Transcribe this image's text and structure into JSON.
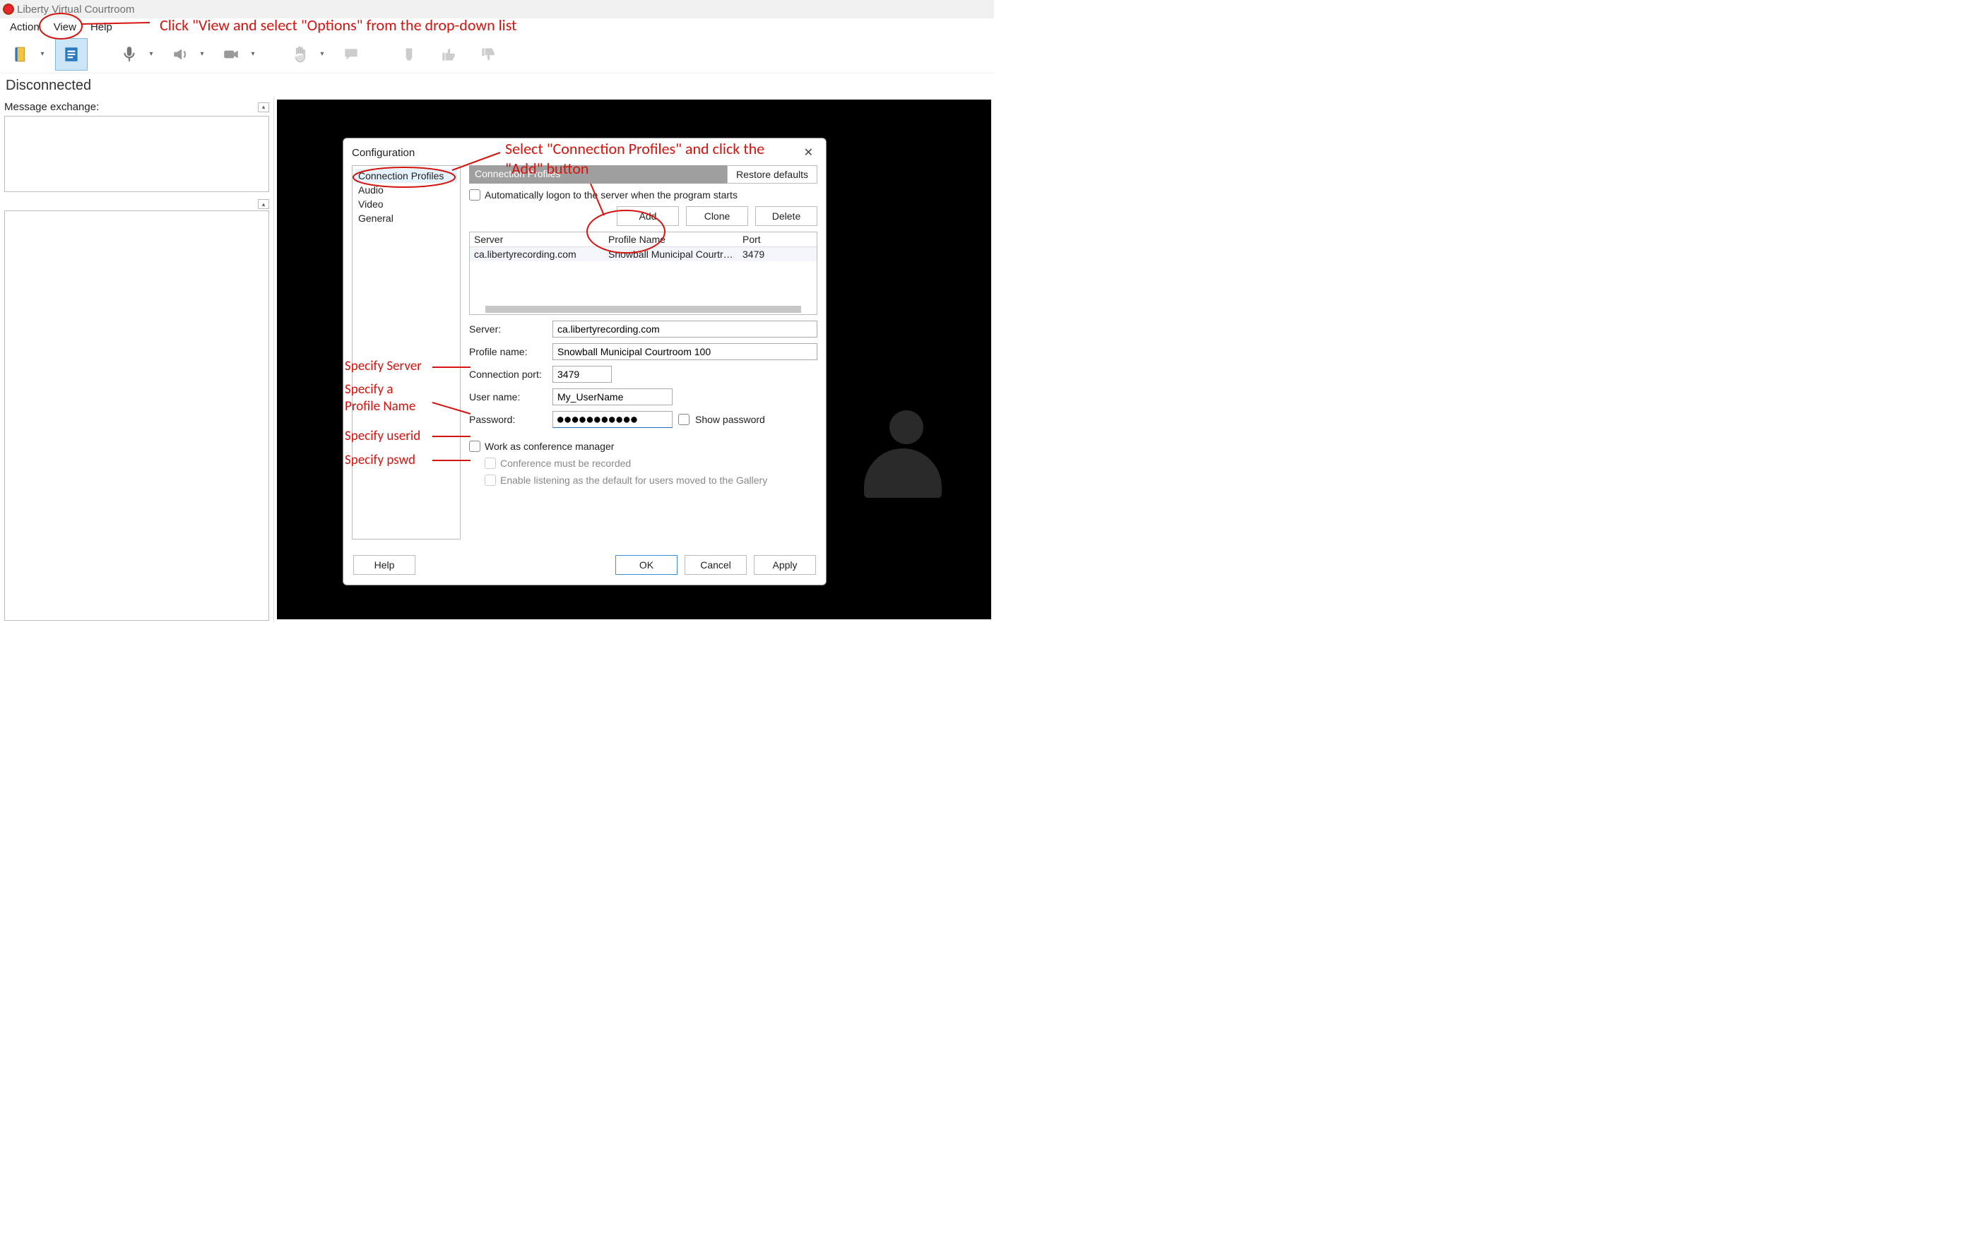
{
  "app": {
    "title": "Liberty Virtual Courtroom"
  },
  "menubar": {
    "action": "Action",
    "view": "View",
    "help": "Help"
  },
  "toolbar": {
    "icons": [
      "door-exit-icon",
      "notes-icon",
      "microphone-icon",
      "speaker-icon",
      "camera-icon",
      "hand-raise-icon",
      "chat-icon",
      "glove-icon",
      "thumb-up-icon",
      "thumb-down-icon"
    ]
  },
  "status": {
    "text": "Disconnected"
  },
  "left": {
    "message_exchange_label": "Message exchange:"
  },
  "dialog": {
    "title": "Configuration",
    "close_glyph": "✕",
    "side": {
      "connection_profiles": "Connection Profiles",
      "audio": "Audio",
      "video": "Video",
      "general": "General"
    },
    "section_title": "Connection Profiles",
    "restore_defaults": "Restore defaults",
    "auto_logon": "Automatically logon to the server when the program starts",
    "buttons": {
      "add": "Add",
      "clone": "Clone",
      "delete": "Delete"
    },
    "table": {
      "headers": {
        "server": "Server",
        "profile": "Profile Name",
        "port": "Port"
      },
      "rows": [
        {
          "server": "ca.libertyrecording.com",
          "profile": "Snowball Municipal Courtroo...",
          "port": "3479"
        }
      ]
    },
    "form": {
      "server_label": "Server:",
      "server_value": "ca.libertyrecording.com",
      "profile_label": "Profile name:",
      "profile_value": "Snowball Municipal Courtroom 100",
      "port_label": "Connection port:",
      "port_value": "3479",
      "user_label": "User name:",
      "user_value": "My_UserName",
      "pass_label": "Password:",
      "pass_value_masked": "●●●●●●●●●●●",
      "show_password": "Show password",
      "work_as_mgr": "Work as conference manager",
      "must_record": "Conference must be recorded",
      "enable_listen": "Enable listening as the default for users moved to the Gallery"
    },
    "footer": {
      "help": "Help",
      "ok": "OK",
      "cancel": "Cancel",
      "apply": "Apply"
    }
  },
  "annotations": {
    "top": "Click \"View and select \"Options\" from the drop-down list",
    "top_right": "Select \"Connection Profiles\" and click the \"Add\" button",
    "server": "Specify Server",
    "profile_a": "Specify a",
    "profile_b": "Profile Name",
    "user": "Specify userid",
    "pass": "Specify pswd"
  }
}
